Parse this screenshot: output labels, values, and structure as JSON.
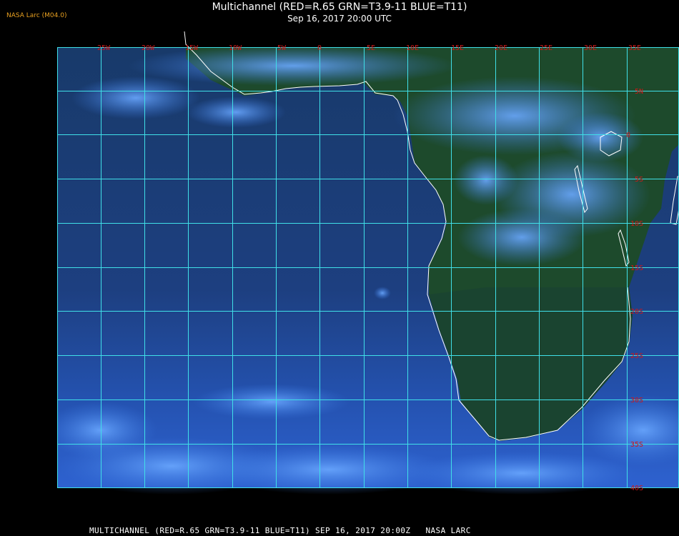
{
  "header": {
    "title": "Multichannel (RED=R.65 GRN=T3.9-11 BLUE=T11)",
    "datetime": "Sep 16, 2017 20:00 UTC",
    "credit": "NASA Larc (M04.0)"
  },
  "footer": {
    "text": "MULTICHANNEL (RED=R.65 GRN=T3.9-11 BLUE=T11) SEP 16, 2017 20:00Z   NASA LARC"
  },
  "map": {
    "longitude_labels": [
      "25W",
      "20W",
      "15W",
      "10W",
      "5W",
      "0",
      "5E",
      "10E",
      "15E",
      "20E",
      "25E",
      "30E",
      "35E"
    ],
    "latitude_labels": [
      "5N",
      "0",
      "5S",
      "10S",
      "15S",
      "20S",
      "25S",
      "30S",
      "35S",
      "40S"
    ],
    "colors": {
      "grid": "#40e0e8",
      "coastline": "#ffffff",
      "labels": "#d01818",
      "ocean": "#1c3c78",
      "land": "#1e4a2a",
      "cloud": "#4a90f0"
    }
  }
}
